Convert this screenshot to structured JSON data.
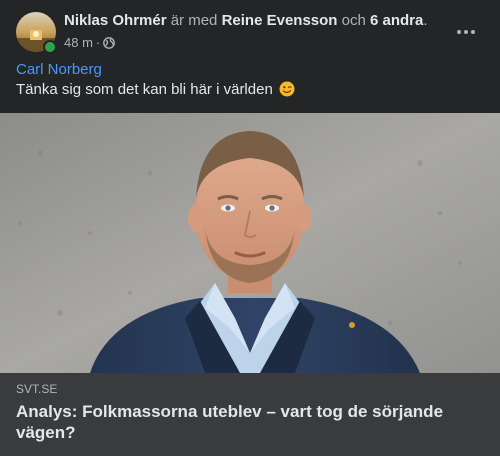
{
  "post": {
    "author": "Niklas Ohrmér",
    "with_text": "är med",
    "tagged_person": "Reine Evensson",
    "and_text": "och",
    "others": "6 andra",
    "period": ".",
    "timestamp": "48 m",
    "separator": "·",
    "privacy_icon": "globe-icon",
    "mention": "Carl Norberg",
    "message": "Tänka sig som det kan bli här i världen",
    "emoji": "winking-face-emoji"
  },
  "link_preview": {
    "source": "SVT.SE",
    "title": "Analys: Folkmassorna uteblev – vart tog de sörjande vägen?"
  },
  "colors": {
    "background": "#242526",
    "link_box": "#3a3b3c",
    "mention": "#4599ff",
    "online": "#31a24c"
  }
}
